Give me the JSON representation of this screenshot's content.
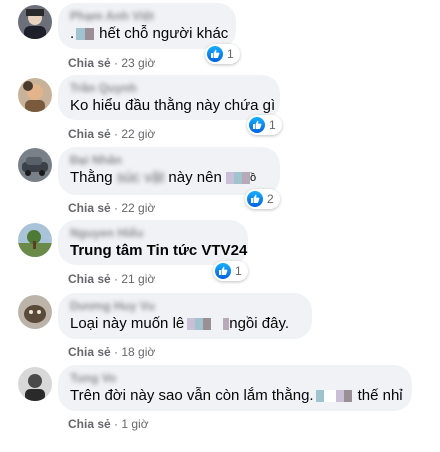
{
  "comments": [
    {
      "author": "Phạm Anh Việt",
      "text_after": "hết chỗ người khác",
      "reaction_count": "1",
      "share_label": "Chia sẻ",
      "dot": "·",
      "time": "23 giờ"
    },
    {
      "author": "Trần Quynh",
      "text": "Ko hiểu đầu thằng này chứa gì",
      "reaction_count": "1",
      "share_label": "Chia sẻ",
      "dot": "·",
      "time": "22 giờ"
    },
    {
      "author": "Đại Nhân",
      "text_before": "Thằng",
      "text_blurred": "súc vật",
      "text_middle": "này nên",
      "text_end": "ồ",
      "reaction_count": "2",
      "share_label": "Chia sẻ",
      "dot": "·",
      "time": "22 giờ"
    },
    {
      "author": "Nguyen Hiếu",
      "text": "Trung tâm Tin tức VTV24",
      "reaction_count": "1",
      "share_label": "Chia sẻ",
      "dot": "·",
      "time": "21 giờ"
    },
    {
      "author": "Dương Huy Vu",
      "text_before": "Loại này muốn lê",
      "text_after": "ngồi đây.",
      "share_label": "Chia sẻ",
      "dot": "·",
      "time": "18 giờ"
    },
    {
      "author": "Tung Vo",
      "text_before": "Trên đời này sao vẫn còn lắm thằng",
      "text_after": "thế nhỉ",
      "share_label": "Chia sẻ",
      "dot": "·",
      "time": "1 giờ"
    }
  ],
  "colors": {
    "bubble": "#f0f2f5",
    "like_blue": "#1877f2",
    "meta_text": "#65676b",
    "censor_teal": "#9fc3cf",
    "censor_gray": "#9a8f94"
  },
  "icons": [
    "like-icon",
    "avatar"
  ]
}
